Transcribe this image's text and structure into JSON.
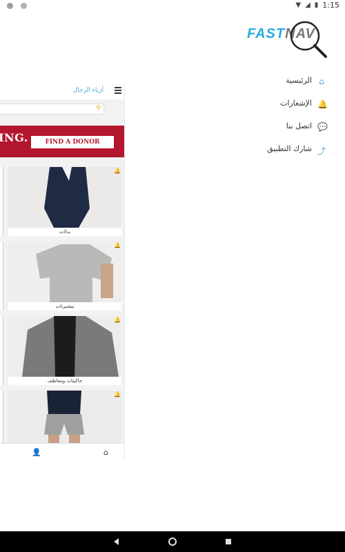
{
  "status": {
    "time": "1:15"
  },
  "page": {
    "title": "أزياء الرجال",
    "banner": {
      "headline": "ING.",
      "button": "FIND A DONOR CENTER"
    },
    "cards": [
      {
        "label": "بدلات"
      },
      {
        "label": "تيشيرتات"
      },
      {
        "label": "جاكيتات ومعاطف"
      },
      {
        "label": ""
      }
    ]
  },
  "logo": {
    "fast": "FAST",
    "nav": "NAV"
  },
  "menu": [
    {
      "label": "الرئيسية",
      "icon": "home-icon"
    },
    {
      "label": "الإشعارات",
      "icon": "bell-icon"
    },
    {
      "label": "اتصل بنا",
      "icon": "chat-icon"
    },
    {
      "label": "شارك التطبيق",
      "icon": "share-icon"
    }
  ],
  "colors": {
    "accent": "#4aa6dc",
    "banner": "#b3172e"
  }
}
